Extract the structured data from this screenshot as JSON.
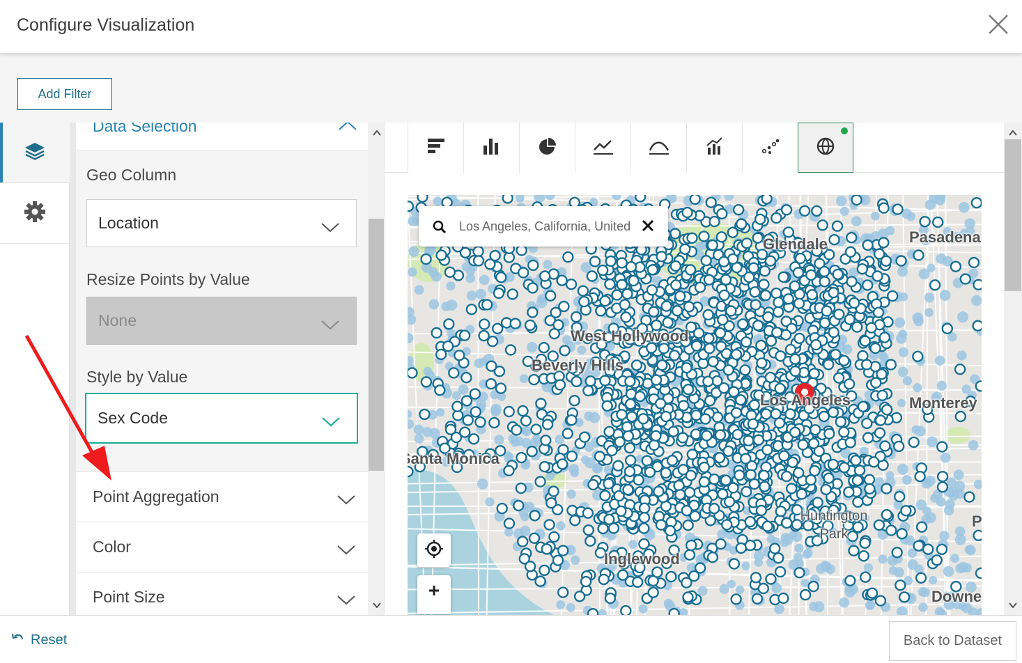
{
  "header": {
    "title": "Configure Visualization",
    "close_icon": "close-icon"
  },
  "filter_bar": {
    "add_filter_label": "Add Filter"
  },
  "left_nav": {
    "items": [
      {
        "icon": "layers-icon",
        "active": true
      },
      {
        "icon": "gear-icon",
        "active": false
      }
    ]
  },
  "panel": {
    "data_selection_label": "Data Selection",
    "geo_column": {
      "label": "Geo Column",
      "value": "Location"
    },
    "resize_points": {
      "label": "Resize Points by Value",
      "value": "None"
    },
    "style_by_value": {
      "label": "Style by Value",
      "value": "Sex Code"
    },
    "sections": [
      "Point Aggregation",
      "Color",
      "Point Size"
    ]
  },
  "chart_toolbar": {
    "icons": [
      "bar-horizontal-icon",
      "bar-vertical-icon",
      "pie-icon",
      "line-icon",
      "area-icon",
      "combo-icon",
      "scatter-icon",
      "globe-icon"
    ],
    "active_index": 7
  },
  "map": {
    "search_value": "Los Angeles, California, United",
    "labels": {
      "glendale": "Glendale",
      "pasadena": "Pasadena",
      "west_hollywood": "West Hollywood",
      "beverly_hills": "Beverly Hills",
      "los_angeles": "Los Angeles",
      "monterey": "Monterey",
      "santa_monica": "Santa Monica",
      "huntington_park": "Huntington Park",
      "inglewood": "Inglewood",
      "downey": "Downey",
      "p": "P"
    },
    "zoom_in_label": "+",
    "colors": {
      "water": "#aad3df",
      "park": "#d5e9b4",
      "land": "#e8e6e3",
      "point_dark": "#1a6f93",
      "point_light": "#9cc6e2",
      "pin": "#e0262b"
    }
  },
  "footer": {
    "reset_label": "Reset",
    "back_label": "Back to Dataset"
  },
  "colors": {
    "accent": "#1f6e8c",
    "focus": "#1aae98",
    "active_dot": "#1fa64a",
    "annotation_arrow": "#ee1c1c"
  }
}
